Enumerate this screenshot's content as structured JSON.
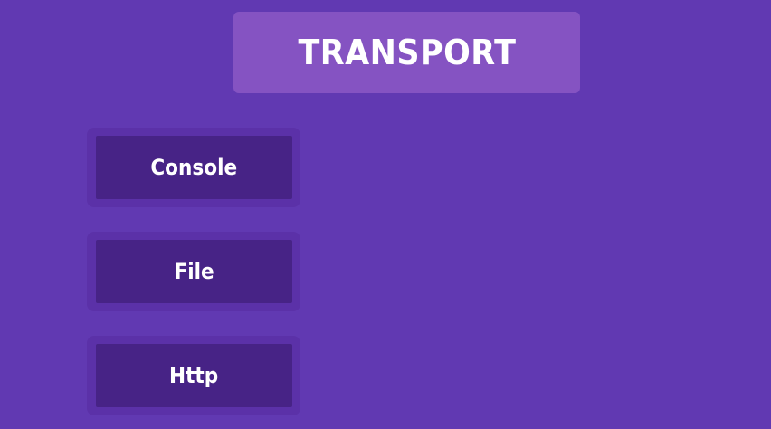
{
  "header": {
    "title": "TRANSPORT"
  },
  "transports": [
    {
      "label": "Console"
    },
    {
      "label": "File"
    },
    {
      "label": "Http"
    }
  ],
  "colors": {
    "background": "#6139b2",
    "title_box": "#8553c2",
    "item_border": "#5b31a8",
    "item_fill": "#472386",
    "text": "#ffffff"
  }
}
